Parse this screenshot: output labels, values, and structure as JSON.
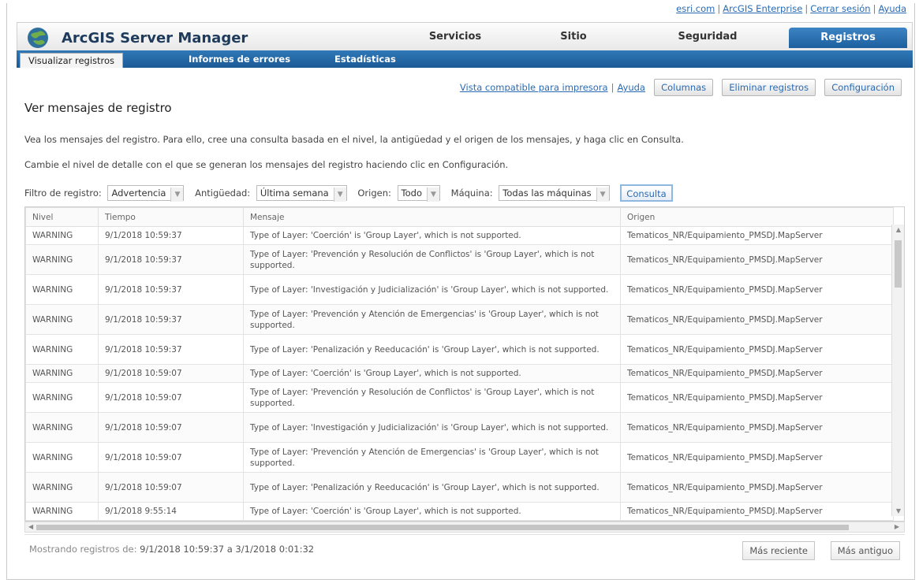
{
  "top_links": {
    "esri": "esri.com",
    "enterprise": "ArcGIS Enterprise",
    "logout": "Cerrar sesión",
    "help": "Ayuda"
  },
  "header": {
    "title": "ArcGIS Server Manager",
    "nav": [
      "Servicios",
      "Sitio",
      "Seguridad",
      "Registros"
    ],
    "active_nav": "Registros"
  },
  "subnav": [
    "Visualizar registros",
    "Informes de errores",
    "Estadísticas"
  ],
  "toolbar": {
    "print_view": "Vista compatible para impresora",
    "help": "Ayuda",
    "columns": "Columnas",
    "delete_logs": "Eliminar registros",
    "settings": "Configuración"
  },
  "page": {
    "title": "Ver mensajes de registro",
    "desc1": "Vea los mensajes del registro. Para ello, cree una consulta basada en el nivel, la antigüedad y el origen de los mensajes, y haga clic en Consulta.",
    "desc2": "Cambie el nivel de detalle con el que se generan los mensajes del registro haciendo clic en Configuración."
  },
  "filters": {
    "log_filter_label": "Filtro de registro:",
    "log_filter_value": "Advertencia",
    "age_label": "Antigüedad:",
    "age_value": "Última semana",
    "origin_label": "Origen:",
    "origin_value": "Todo",
    "machine_label": "Máquina:",
    "machine_value": "Todas las máquinas",
    "query_button": "Consulta"
  },
  "table": {
    "headers": [
      "Nivel",
      "Tiempo",
      "Mensaje",
      "Origen"
    ],
    "rows": [
      [
        "WARNING",
        "9/1/2018 10:59:37",
        "Type of Layer: 'Coerción' is 'Group Layer', which is not supported.",
        "Tematicos_NR/Equipamiento_PMSDJ.MapServer"
      ],
      [
        "WARNING",
        "9/1/2018 10:59:37",
        "Type of Layer: 'Prevención y Resolución de Conflictos' is 'Group Layer', which is not supported.",
        "Tematicos_NR/Equipamiento_PMSDJ.MapServer"
      ],
      [
        "WARNING",
        "9/1/2018 10:59:37",
        "Type of Layer: 'Investigación y Judicialización' is 'Group Layer', which is not supported.",
        "Tematicos_NR/Equipamiento_PMSDJ.MapServer"
      ],
      [
        "WARNING",
        "9/1/2018 10:59:37",
        "Type of Layer: 'Prevención y Atención de Emergencias' is 'Group Layer', which is not supported.",
        "Tematicos_NR/Equipamiento_PMSDJ.MapServer"
      ],
      [
        "WARNING",
        "9/1/2018 10:59:37",
        "Type of Layer: 'Penalización y Reeducación' is 'Group Layer', which is not supported.",
        "Tematicos_NR/Equipamiento_PMSDJ.MapServer"
      ],
      [
        "WARNING",
        "9/1/2018 10:59:07",
        "Type of Layer: 'Coerción' is 'Group Layer', which is not supported.",
        "Tematicos_NR/Equipamiento_PMSDJ.MapServer"
      ],
      [
        "WARNING",
        "9/1/2018 10:59:07",
        "Type of Layer: 'Prevención y Resolución de Conflictos' is 'Group Layer', which is not supported.",
        "Tematicos_NR/Equipamiento_PMSDJ.MapServer"
      ],
      [
        "WARNING",
        "9/1/2018 10:59:07",
        "Type of Layer: 'Investigación y Judicialización' is 'Group Layer', which is not supported.",
        "Tematicos_NR/Equipamiento_PMSDJ.MapServer"
      ],
      [
        "WARNING",
        "9/1/2018 10:59:07",
        "Type of Layer: 'Prevención y Atención de Emergencias' is 'Group Layer', which is not supported.",
        "Tematicos_NR/Equipamiento_PMSDJ.MapServer"
      ],
      [
        "WARNING",
        "9/1/2018 10:59:07",
        "Type of Layer: 'Penalización y Reeducación' is 'Group Layer', which is not supported.",
        "Tematicos_NR/Equipamiento_PMSDJ.MapServer"
      ],
      [
        "WARNING",
        "9/1/2018 9:55:14",
        "Type of Layer: 'Coerción' is 'Group Layer', which is not supported.",
        "Tematicos_NR/Equipamiento_PMSDJ.MapServer"
      ]
    ]
  },
  "footer": {
    "showing_label": "Mostrando registros de:",
    "range": "9/1/2018 10:59:37 a 3/1/2018 0:01:32",
    "newer": "Más reciente",
    "older": "Más antiguo"
  },
  "colors": {
    "accent": "#1d5f9e",
    "link": "#2a6bb3"
  }
}
